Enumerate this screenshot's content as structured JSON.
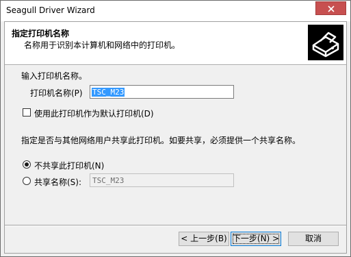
{
  "window": {
    "title": "Seagull Driver Wizard"
  },
  "header": {
    "title": "指定打印机名称",
    "subtitle": "名称用于识别本计算机和网络中的打印机。",
    "logo_icon": "printer-logo-icon"
  },
  "form": {
    "prompt": "输入打印机名称。",
    "name_label": "打印机名称(P)",
    "name_value": "TSC_M23",
    "default_checkbox_label": "使用此打印机作为默认打印机(D)",
    "default_checked": false,
    "share_prompt": "指定是否与其他网络用户共享此打印机。如要共享，必须提供一个共享名称。",
    "no_share_label": "不共享此打印机(N)",
    "no_share_selected": true,
    "share_label": "共享名称(S):",
    "share_value": "TSC_M23"
  },
  "buttons": {
    "back": "< 上一步(B)",
    "next": "下一步(N) >",
    "cancel": "取消"
  },
  "colors": {
    "close_button": "#c75050",
    "selection": "#3399ff",
    "default_button_border": "#0078d7"
  }
}
